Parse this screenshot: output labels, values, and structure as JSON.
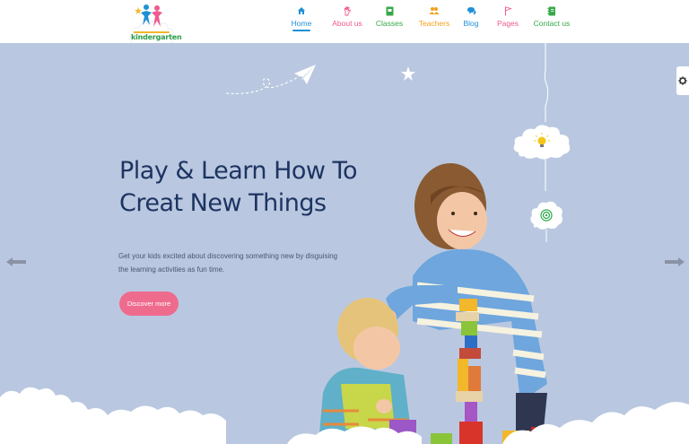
{
  "brand": {
    "name": "kindergarten"
  },
  "nav": {
    "items": [
      {
        "label": "Home",
        "color": "#1e90d6",
        "icon": "home-icon",
        "active": true
      },
      {
        "label": "About us",
        "color": "#ef5b8e",
        "icon": "hand-icon",
        "active": false
      },
      {
        "label": "Classes",
        "color": "#37a84a",
        "icon": "book-icon",
        "active": false
      },
      {
        "label": "Teachers",
        "color": "#f2a11b",
        "icon": "users-icon",
        "active": false
      },
      {
        "label": "Blog",
        "color": "#1e90d6",
        "icon": "chat-icon",
        "active": false
      },
      {
        "label": "Pages",
        "color": "#ef5b8e",
        "icon": "flag-icon",
        "active": false
      },
      {
        "label": "Contact us",
        "color": "#37a84a",
        "icon": "contact-book-icon",
        "active": false
      }
    ]
  },
  "hero": {
    "title_line1": "Play & Learn How To",
    "title_line2": "Creat New Things",
    "description": "Get your kids excited about discovering something new by disguising the learning activities as fun time.",
    "button_label": "Discover more"
  },
  "colors": {
    "background": "#b9c8e0",
    "title": "#1d3461",
    "button": "#ef6b8e"
  }
}
